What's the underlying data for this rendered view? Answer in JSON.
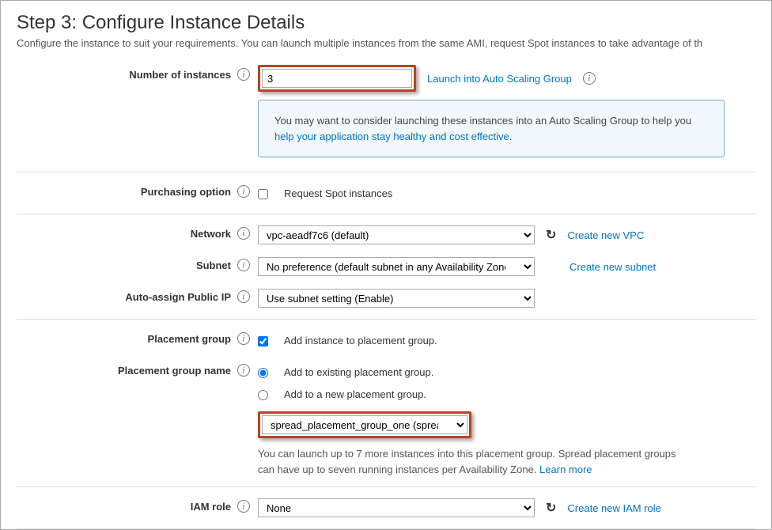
{
  "header": {
    "title": "Step 3: Configure Instance Details",
    "subtitle": "Configure the instance to suit your requirements. You can launch multiple instances from the same AMI, request Spot instances to take advantage of th"
  },
  "instances": {
    "label": "Number of instances",
    "value": "3",
    "link": "Launch into Auto Scaling Group"
  },
  "notice": {
    "text1": "You may want to consider launching these instances into an Auto Scaling Group to help you ",
    "link": "help your application stay healthy and cost effective",
    "dot": "."
  },
  "purchasing": {
    "label": "Purchasing option",
    "checkbox_label": "Request Spot instances"
  },
  "network": {
    "label": "Network",
    "value": "vpc-aeadf7c6 (default)",
    "link": "Create new VPC"
  },
  "subnet": {
    "label": "Subnet",
    "value": "No preference (default subnet in any Availability Zone)",
    "link": "Create new subnet"
  },
  "publicip": {
    "label": "Auto-assign Public IP",
    "value": "Use subnet setting (Enable)"
  },
  "placement": {
    "label": "Placement group",
    "checkbox_label": "Add instance to placement group."
  },
  "placement_name": {
    "label": "Placement group name",
    "radio1": "Add to existing placement group.",
    "radio2": "Add to a new placement group.",
    "select_value": "spread_placement_group_one (spread)",
    "help_pre": "You can launch up to 7 more instances into this placement group. Spread placement groups can have up to seven running instances per Availability Zone. ",
    "learn": "Learn more"
  },
  "iam": {
    "label": "IAM role",
    "value": "None",
    "link": "Create new IAM role"
  }
}
